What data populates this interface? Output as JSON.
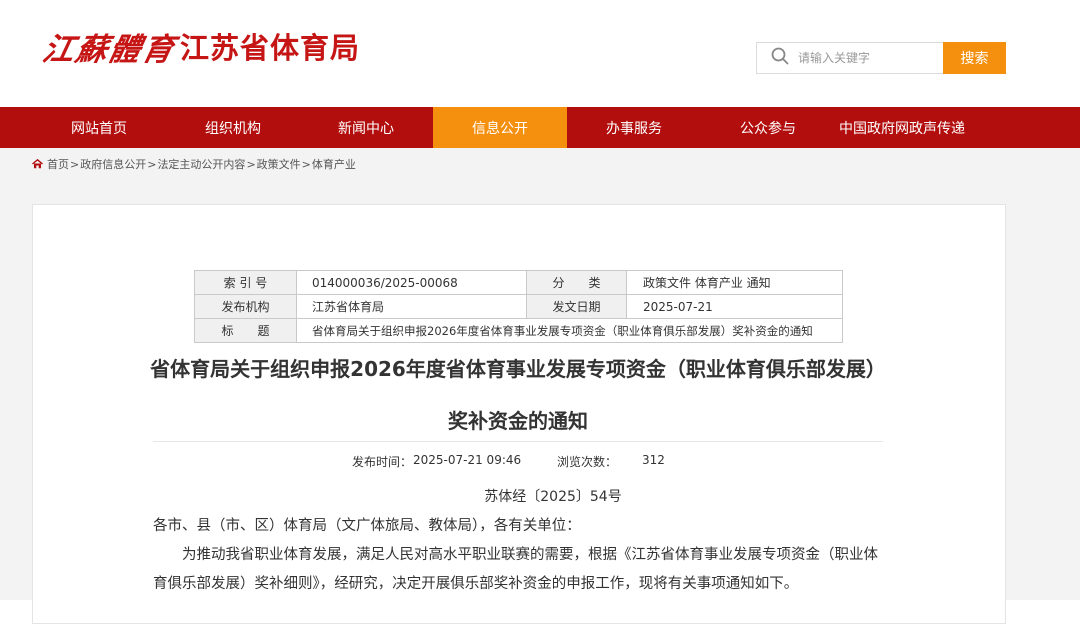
{
  "site": {
    "logo_script": "江蘇體育",
    "logo_name": "江苏省体育局"
  },
  "search": {
    "placeholder": "请输入关键字",
    "button_label": "搜索"
  },
  "nav": {
    "items": [
      {
        "label": "网站首页"
      },
      {
        "label": "组织机构"
      },
      {
        "label": "新闻中心"
      },
      {
        "label": "信息公开",
        "active": true
      },
      {
        "label": "办事服务"
      },
      {
        "label": "公众参与"
      },
      {
        "label": "中国政府网政声传递"
      }
    ]
  },
  "breadcrumb": {
    "items": [
      "首页",
      "政府信息公开",
      "法定主动公开内容",
      "政策文件",
      "体育产业"
    ],
    "separator": ">"
  },
  "meta": {
    "index_label": "索 引 号",
    "index_value": "014000036/2025-00068",
    "category_label": "分　　类",
    "category_value": "政策文件 体育产业 通知",
    "publisher_label": "发布机构",
    "publisher_value": "江苏省体育局",
    "date_label": "发文日期",
    "date_value": "2025-07-21",
    "title_label": "标　　题",
    "title_value": "省体育局关于组织申报2026年度省体育事业发展专项资金（职业体育俱乐部发展）奖补资金的通知"
  },
  "article": {
    "title": "省体育局关于组织申报2026年度省体育事业发展专项资金（职业体育俱乐部发展）奖补资金的通知",
    "publish_label": "发布时间：",
    "publish_time": "2025-07-21 09:46",
    "views_label": "浏览次数：",
    "views": "312",
    "doc_number": "苏体经〔2025〕54号",
    "addressee": "各市、县（市、区）体育局（文广体旅局、教体局），各有关单位：",
    "paragraph1": "为推动我省职业体育发展，满足人民对高水平职业联赛的需要，根据《江苏省体育事业发展专项资金（职业体育俱乐部发展）奖补细则》，经研究，决定开展俱乐部奖补资金的申报工作，现将有关事项通知如下。"
  },
  "colors": {
    "brand_red": "#b30e0e",
    "accent_orange": "#f5900f",
    "logo_red": "#c61515"
  }
}
